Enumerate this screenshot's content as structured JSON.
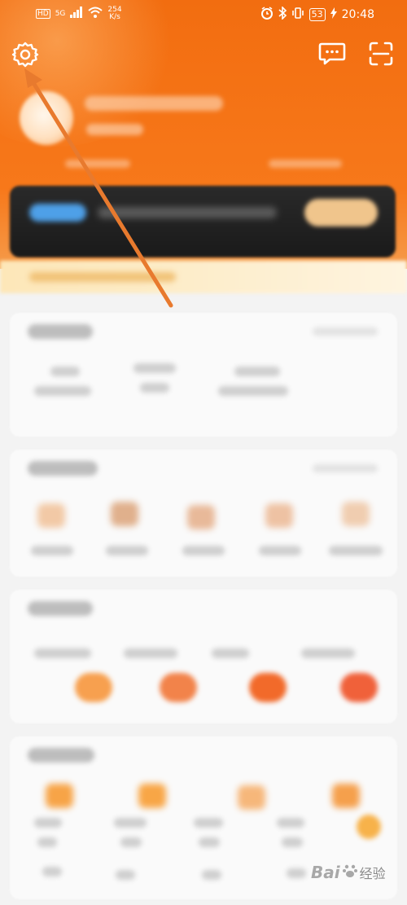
{
  "status_bar": {
    "left_signal": "HD",
    "network": "5G",
    "speed_value": "254",
    "speed_unit": "K/s",
    "battery": "53",
    "time": "20:48"
  },
  "header": {
    "settings_icon": "gear-icon",
    "message_icon": "message-icon",
    "scan_icon": "scan-icon",
    "accent_color": "#f26d10"
  },
  "annotation": {
    "arrow_color": "#e87a2e",
    "target": "settings-button"
  },
  "watermark": {
    "brand": "Bai",
    "brand_suffix": "经验",
    "site": "jingyan.baidu.com"
  }
}
